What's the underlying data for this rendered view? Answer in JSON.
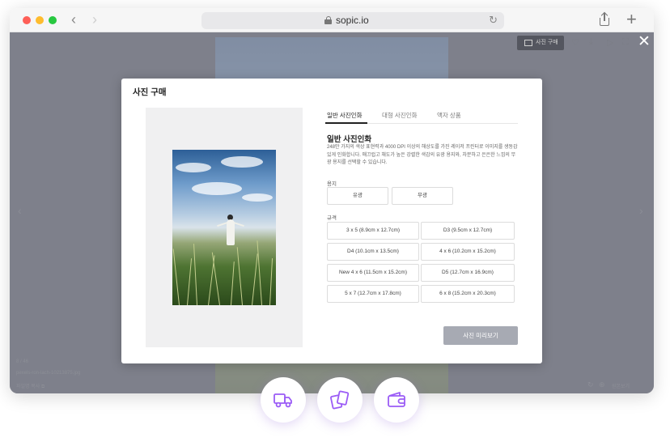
{
  "browser": {
    "url": "sopic.io"
  },
  "viewer": {
    "buy_chip_label": "사진 구매",
    "counter": "8 / 46",
    "filename": "pexels-ron-lach-10213875.jpg",
    "copy_link_label": "파일명 복사",
    "original_label": "원본보기"
  },
  "modal": {
    "title": "사진 구매",
    "tabs": [
      {
        "label": "일반 사진인화"
      },
      {
        "label": "대형 사진인화"
      },
      {
        "label": "액자 상품"
      }
    ],
    "section_title": "일반 사진인화",
    "description": "248만 가지의 색상 표현력과 4000 DPI 이상의 해상도를 가진 레이저 프린터로 이미지를 생동감 있게 인화합니다. 매끄럽고 채도가 높은 강렬한 색감의 유광 용지와, 차분하고 은은한 느낌의 무광 용지를 선택할 수 있습니다.",
    "paper_label": "용지",
    "paper_options": [
      {
        "label": "유광"
      },
      {
        "label": "무광"
      }
    ],
    "size_label": "규격",
    "size_options": [
      {
        "label": "3 x 5 (8.9cm x 12.7cm)"
      },
      {
        "label": "D3 (9.5cm x 12.7cm)"
      },
      {
        "label": "D4 (10.1cm x 13.5cm)"
      },
      {
        "label": "4 x 6 (10.2cm x 15.2cm)"
      },
      {
        "label": "New 4 x 6 (11.5cm x 15.2cm)"
      },
      {
        "label": "D5 (12.7cm x 16.9cm)"
      },
      {
        "label": "5 x 7 (12.7cm x 17.8cm)"
      },
      {
        "label": "6 x 8 (15.2cm x 20.3cm)"
      }
    ],
    "preview_button_label": "사진 미리보기"
  },
  "colors": {
    "accent_purple": "#9b5cf6",
    "button_gray": "#a7aab3"
  },
  "feature_icons": [
    "delivery-truck-icon",
    "photo-print-icon",
    "wallet-icon"
  ]
}
